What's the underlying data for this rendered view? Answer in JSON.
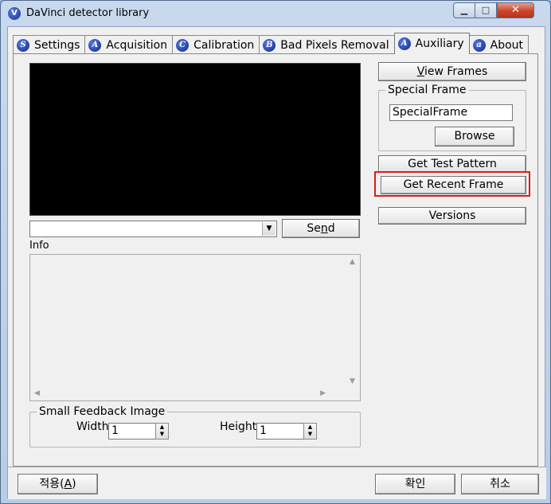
{
  "window": {
    "title": "DaVinci detector library",
    "icon_letter": "V"
  },
  "titlebar_buttons": {
    "minimize": "▁",
    "maximize": "□",
    "close": "✕"
  },
  "tabs": [
    {
      "label": "Settings",
      "icon": "S"
    },
    {
      "label": "Acquisition",
      "icon": "A"
    },
    {
      "label": "Calibration",
      "icon": "C"
    },
    {
      "label": "Bad Pixels Removal",
      "icon": "B"
    },
    {
      "label": "Auxiliary",
      "icon": "A"
    },
    {
      "label": "About",
      "icon": "a"
    }
  ],
  "active_tab": "Auxiliary",
  "auxiliary": {
    "combo_value": "",
    "send_pre": "Se",
    "send_u": "n",
    "send_post": "d",
    "info_label": "Info",
    "info_text": "",
    "view_frames_u": "V",
    "view_frames_post": "iew Frames",
    "special_frame_group": "Special Frame",
    "special_frame_value": "SpecialFrame",
    "browse": "Browse",
    "get_test_pattern": "Get Test Pattern",
    "get_recent_frame": "Get Recent Frame",
    "versions": "Versions",
    "feedback_group": "Small Feedback Image",
    "width_label": "Width",
    "width_value": "1",
    "height_label": "Height",
    "height_value": "1"
  },
  "dialog_buttons": {
    "apply_pre": "적용(",
    "apply_u": "A",
    "apply_post": ")",
    "ok": "확인",
    "cancel": "취소"
  },
  "highlight_color": "#e01b1b"
}
